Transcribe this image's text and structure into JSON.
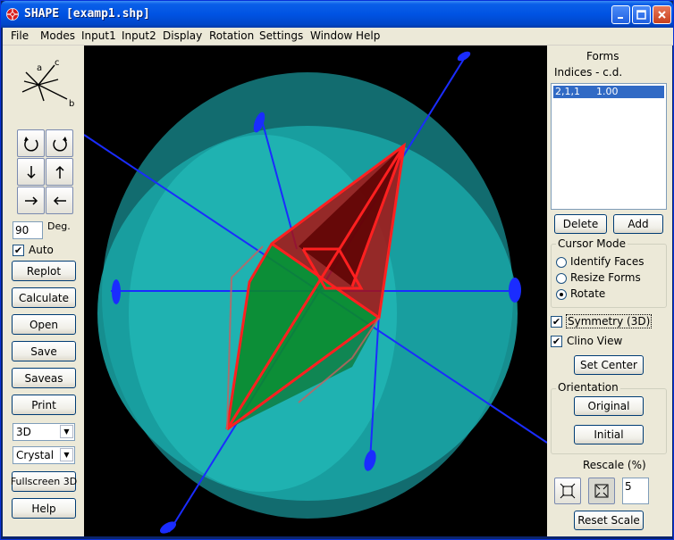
{
  "window": {
    "title": "SHAPE [examp1.shp]"
  },
  "menu": [
    "File",
    "Modes",
    "Input1",
    "Input2",
    "Display",
    "Rotation",
    "Settings",
    "Window",
    "Help"
  ],
  "left": {
    "axes": {
      "a": "a",
      "b": "b",
      "c": "c"
    },
    "degrees_value": "90",
    "degrees_label": "Deg.",
    "auto_label": "Auto",
    "auto_checked": true,
    "buttons": {
      "replot": "Replot",
      "calculate": "Calculate",
      "open": "Open",
      "save": "Save",
      "saveas": "Saveas",
      "print": "Print",
      "fullscreen": "Fullscreen 3D",
      "help": "Help"
    },
    "view_mode": "3D",
    "model_type": "Crystal"
  },
  "right": {
    "forms_title": "Forms",
    "indices_header": "Indices - c.d.",
    "forms_list": [
      {
        "indices": "2,1,1",
        "cd": "1.00"
      }
    ],
    "delete_label": "Delete",
    "add_label": "Add",
    "cursor_mode": {
      "title": "Cursor Mode",
      "options": [
        "Identify Faces",
        "Resize Forms",
        "Rotate"
      ],
      "selected": "Rotate"
    },
    "symmetry_label": "Symmetry (3D)",
    "symmetry_checked": true,
    "clino_label": "Clino View",
    "clino_checked": true,
    "set_center_label": "Set Center",
    "orientation": {
      "title": "Orientation",
      "original": "Original",
      "initial": "Initial"
    },
    "rescale_title": "Rescale (%)",
    "rescale_value": "5",
    "reset_scale_label": "Reset Scale"
  },
  "colors": {
    "titlebar": "#0053e3",
    "viewport_bg": "#000000",
    "sphere": "#1a9a9a",
    "crystal_edge": "#ff2020",
    "crystal_face": "#0a8a2a",
    "axis": "#2030ff",
    "selection": "#316ac5"
  }
}
